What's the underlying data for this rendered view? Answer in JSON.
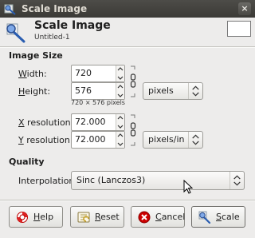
{
  "window": {
    "title": "Scale Image",
    "close_glyph": "×"
  },
  "header": {
    "title": "Scale Image",
    "subtitle": "Untitled-1",
    "icon": "scale-image-icon"
  },
  "image_size": {
    "section_label": "Image Size",
    "width": {
      "label_mnemonic": "W",
      "label_rest": "idth:",
      "value": "720"
    },
    "height": {
      "label_mnemonic": "",
      "label_pre": "H",
      "label_rest": "eight:",
      "value": "576"
    },
    "size_unit": "pixels",
    "size_summary": "720 × 576 pixels",
    "x_res": {
      "label_mnemonic": "X",
      "label_rest": " resolution:",
      "value": "72.000"
    },
    "y_res": {
      "label_mnemonic": "Y",
      "label_rest": " resolution:",
      "value": "72.000"
    },
    "res_unit": "pixels/in"
  },
  "quality": {
    "section_label": "Quality",
    "interpolation_label": "Interpolation:",
    "interpolation_value": "Sinc (Lanczos3)"
  },
  "buttons": {
    "help": {
      "mnemonic": "H",
      "rest": "elp",
      "icon": "help-lifebuoy-icon"
    },
    "reset": {
      "mnemonic": "R",
      "rest": "eset",
      "icon": "reset-icon"
    },
    "cancel": {
      "mnemonic": "C",
      "rest": "ancel",
      "icon": "cancel-icon"
    },
    "scale": {
      "mnemonic": "S",
      "rest": "cale",
      "icon": "scale-icon"
    }
  },
  "colors": {
    "accent_red": "#cc0000",
    "titlebar": "#3f3e3a",
    "dialog_bg": "#edeceb"
  }
}
